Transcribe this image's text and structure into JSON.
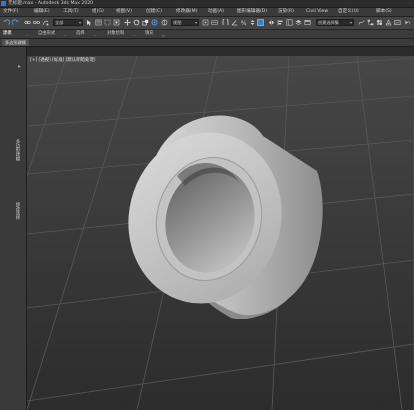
{
  "titlebar": {
    "title": "无标题.max - Autodesk 3ds Max 2020"
  },
  "menubar": {
    "items": [
      "文件(F)",
      "编辑(E)",
      "工具(T)",
      "组(G)",
      "视图(V)",
      "创建(C)",
      "修改器(M)",
      "动画(A)",
      "图形编辑器(D)",
      "渲染(R)",
      "Civil View",
      "自定义(U)",
      "脚本(S)"
    ]
  },
  "toolbar": {
    "filter_dropdown": "全部",
    "view_dropdown": "视图",
    "selection_set_dropdown": "创建选择集"
  },
  "ribbon": {
    "tabs": [
      "建模",
      "自由形式",
      "选择",
      "对象绘制",
      "填充"
    ]
  },
  "subbar": {
    "label": "多边形建模"
  },
  "leftpanel": {
    "labels": [
      "多边形建模",
      "修改选择"
    ]
  },
  "viewport": {
    "label": "[+] [透视] [标准] [默认明暗处理]"
  },
  "colors": {
    "accent": "#2e79c9",
    "viewport_bg": "#3f3f3f",
    "grid": "#5a5a5a",
    "object": "#b8b8b8"
  }
}
